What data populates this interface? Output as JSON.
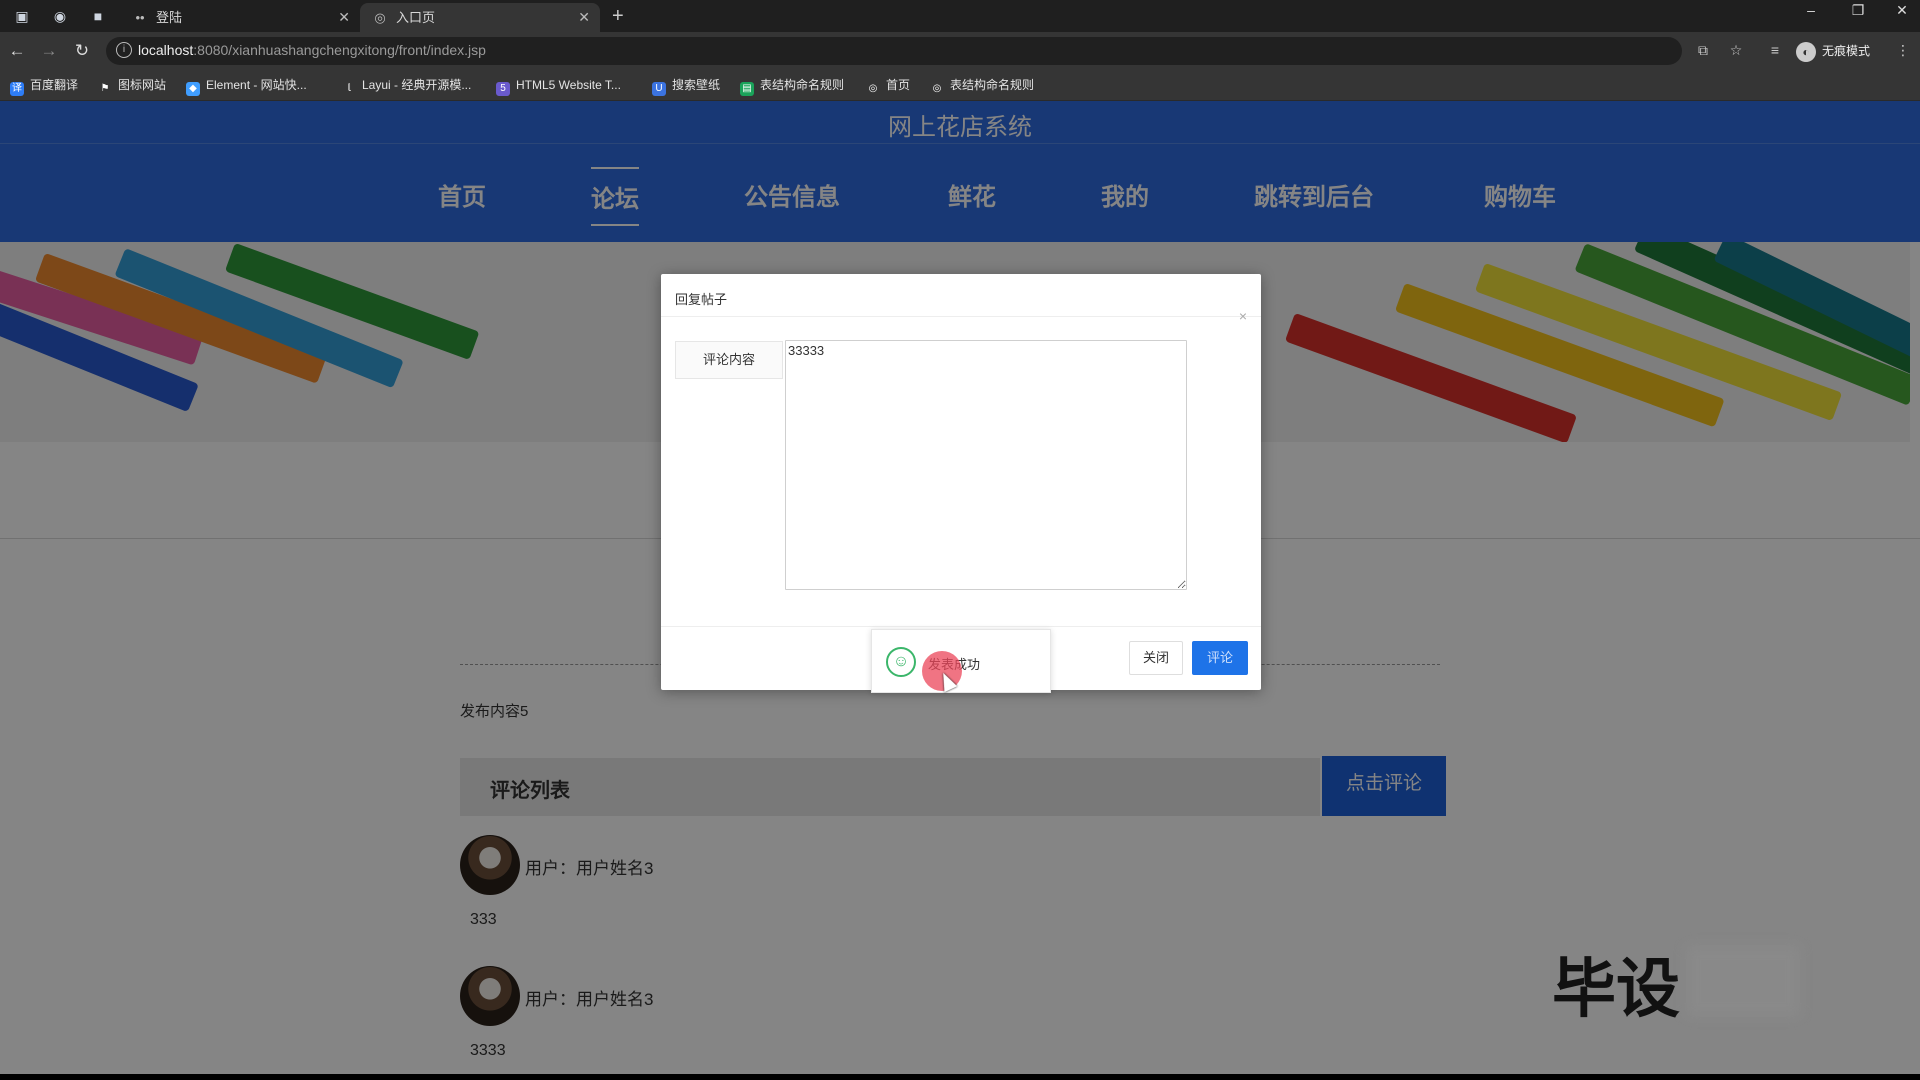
{
  "browser": {
    "tabs": [
      {
        "label": "登陆",
        "active": false
      },
      {
        "label": "入口页",
        "active": true
      }
    ],
    "url_host": "localhost",
    "url_path": ":8080/xianhuashangchengxitong/front/index.jsp",
    "profile_label": "无痕模式",
    "bookmarks": [
      "百度翻译",
      "图标网站",
      "Element - 网站快...",
      "Layui - 经典开源模...",
      "HTML5 Website T...",
      "搜索壁纸",
      "表结构命名规则",
      "首页",
      "表结构命名规则"
    ]
  },
  "site": {
    "title": "网上花店系统",
    "nav": [
      "首页",
      "论坛",
      "公告信息",
      "鲜花",
      "我的",
      "跳转到后台",
      "购物车"
    ],
    "active_nav": "论坛"
  },
  "post": {
    "content": "发布内容5",
    "comment_list_title": "评论列表",
    "comment_button": "点击评论",
    "comments": [
      {
        "user": "用户：用户姓名3",
        "text": "333"
      },
      {
        "user": "用户：用户姓名3",
        "text": "3333"
      }
    ]
  },
  "modal": {
    "title": "回复帖子",
    "close_icon": "×",
    "field_label": "评论内容",
    "field_value": "33333",
    "btn_close": "关闭",
    "btn_submit": "评论"
  },
  "toast": {
    "text": "发表成功",
    "icon": "smile-icon"
  },
  "watermark": "毕设"
}
